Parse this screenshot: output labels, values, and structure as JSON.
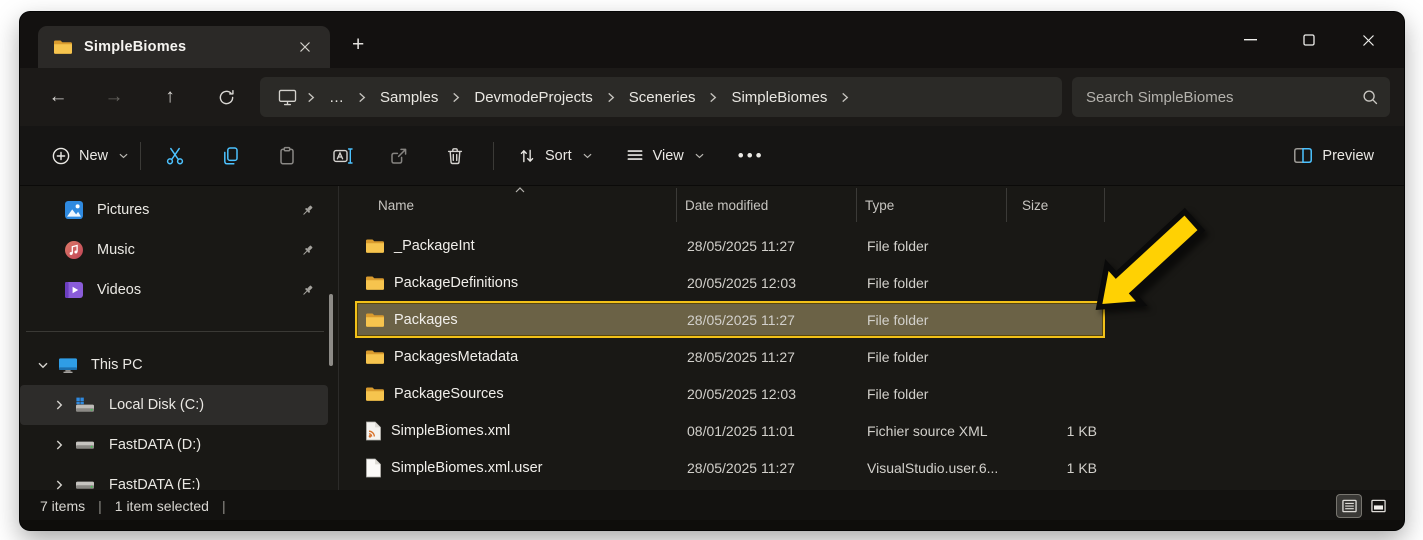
{
  "tab": {
    "title": "SimpleBiomes"
  },
  "breadcrumb": {
    "crumbs": [
      {
        "label": "…"
      },
      {
        "label": "Samples"
      },
      {
        "label": "DevmodeProjects"
      },
      {
        "label": "Sceneries"
      },
      {
        "label": "SimpleBiomes"
      }
    ]
  },
  "search": {
    "placeholder": "Search SimpleBiomes"
  },
  "nav_icons": {
    "back": "←",
    "forward": "→",
    "up": "↑"
  },
  "toolbar": {
    "new_label": "New",
    "sort_label": "Sort",
    "view_label": "View",
    "more_glyph": "•••",
    "preview_label": "Preview"
  },
  "sidebar": {
    "pinned": [
      {
        "label": "Pictures"
      },
      {
        "label": "Music"
      },
      {
        "label": "Videos"
      }
    ],
    "tree": [
      {
        "label": "This PC"
      },
      {
        "label": "Local Disk (C:)"
      },
      {
        "label": "FastDATA (D:)"
      },
      {
        "label": "FastDATA (E:)"
      }
    ]
  },
  "file_list": {
    "columns": {
      "name": "Name",
      "date": "Date modified",
      "type": "Type",
      "size": "Size"
    },
    "rows": [
      {
        "name": "_PackageInt",
        "date": "28/05/2025 11:27",
        "type": "File folder",
        "size": ""
      },
      {
        "name": "PackageDefinitions",
        "date": "20/05/2025 12:03",
        "type": "File folder",
        "size": ""
      },
      {
        "name": "Packages",
        "date": "28/05/2025 11:27",
        "type": "File folder",
        "size": ""
      },
      {
        "name": "PackagesMetadata",
        "date": "28/05/2025 11:27",
        "type": "File folder",
        "size": ""
      },
      {
        "name": "PackageSources",
        "date": "20/05/2025 12:03",
        "type": "File folder",
        "size": ""
      },
      {
        "name": "SimpleBiomes.xml",
        "date": "08/01/2025 11:01",
        "type": "Fichier source XML",
        "size": "1 KB"
      },
      {
        "name": "SimpleBiomes.xml.user",
        "date": "28/05/2025 11:27",
        "type": "VisualStudio.user.6...",
        "size": "1 KB"
      }
    ]
  },
  "status": {
    "items": "7 items",
    "separator": "|",
    "selected": "1 item selected"
  },
  "colors": {
    "accent_blue": "#4cc2ff",
    "highlight_yellow": "#ffd103",
    "selected_row_bg": "#6b6246",
    "folder_yellow": "#f0b73e"
  }
}
